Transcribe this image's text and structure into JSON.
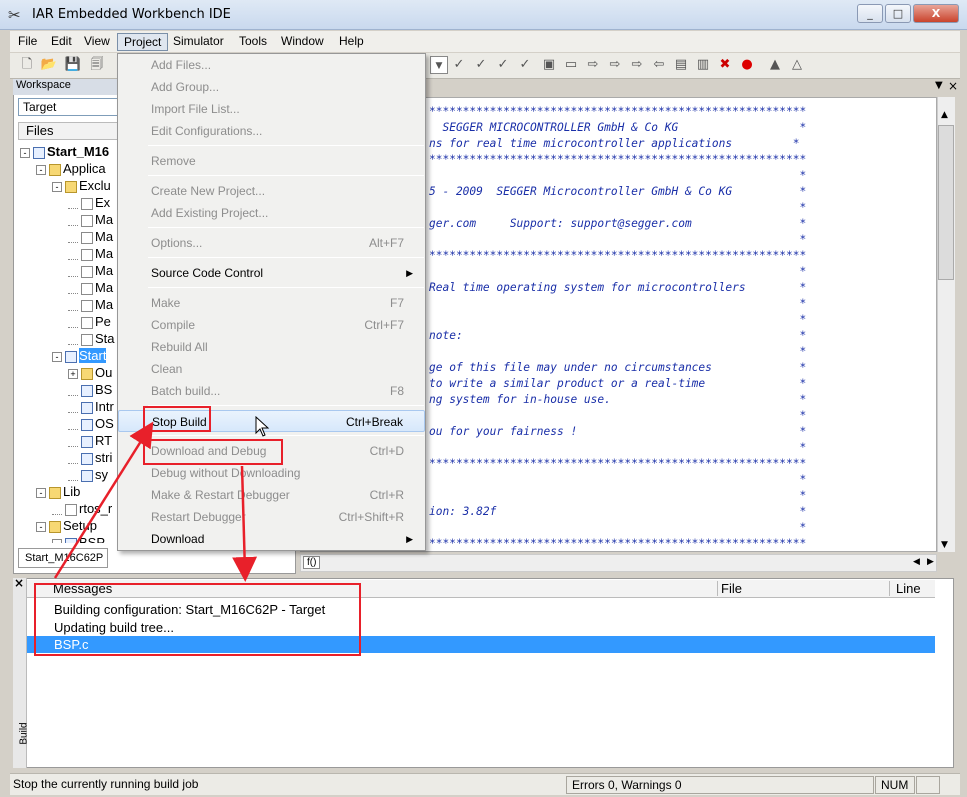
{
  "window": {
    "title": "IAR Embedded Workbench IDE",
    "icon": "iar-tool-icon"
  },
  "window_buttons": [
    "_",
    "□",
    "X"
  ],
  "menubar": [
    "File",
    "Edit",
    "View",
    "Project",
    "Simulator",
    "Tools",
    "Window",
    "Help"
  ],
  "workspace": {
    "header": "Workspace",
    "config": "Target",
    "files_header": "Files",
    "tab": "Start_M16C62P",
    "tree": [
      {
        "indent": 0,
        "text": "Start_M16",
        "icon": "project-icon",
        "exp": "-",
        "bold": true
      },
      {
        "indent": 1,
        "text": "Applica",
        "icon": "folder-icon",
        "exp": "-"
      },
      {
        "indent": 2,
        "text": "Exclu",
        "icon": "excluded-folder-icon",
        "exp": "-"
      },
      {
        "indent": 3,
        "text": "Ex",
        "icon": "excluded-file-icon",
        "exp": ""
      },
      {
        "indent": 3,
        "text": "Ma",
        "icon": "excluded-file-icon",
        "exp": ""
      },
      {
        "indent": 3,
        "text": "Ma",
        "icon": "excluded-file-icon",
        "exp": ""
      },
      {
        "indent": 3,
        "text": "Ma",
        "icon": "excluded-file-icon",
        "exp": ""
      },
      {
        "indent": 3,
        "text": "Ma",
        "icon": "excluded-file-icon",
        "exp": ""
      },
      {
        "indent": 3,
        "text": "Ma",
        "icon": "excluded-file-icon",
        "exp": ""
      },
      {
        "indent": 3,
        "text": "Ma",
        "icon": "excluded-file-icon",
        "exp": ""
      },
      {
        "indent": 3,
        "text": "Pe",
        "icon": "excluded-file-icon",
        "exp": ""
      },
      {
        "indent": 3,
        "text": "Sta",
        "icon": "excluded-file-icon",
        "exp": ""
      },
      {
        "indent": 2,
        "text": "Start",
        "icon": "c-file-icon",
        "exp": "-",
        "selected": true
      },
      {
        "indent": 3,
        "text": "Ou",
        "icon": "folder-icon",
        "exp": "+"
      },
      {
        "indent": 3,
        "text": "BS",
        "icon": "h-file-icon",
        "exp": ""
      },
      {
        "indent": 3,
        "text": "Intr",
        "icon": "h-file-icon",
        "exp": ""
      },
      {
        "indent": 3,
        "text": "OS",
        "icon": "h-file-icon",
        "exp": ""
      },
      {
        "indent": 3,
        "text": "RT",
        "icon": "h-file-icon",
        "exp": ""
      },
      {
        "indent": 3,
        "text": "stri",
        "icon": "h-file-icon",
        "exp": ""
      },
      {
        "indent": 3,
        "text": "sy",
        "icon": "h-file-icon",
        "exp": ""
      },
      {
        "indent": 1,
        "text": "Lib",
        "icon": "folder-icon",
        "exp": "-"
      },
      {
        "indent": 2,
        "text": "rtos_r",
        "icon": "lib-file-icon",
        "exp": ""
      },
      {
        "indent": 1,
        "text": "Setup",
        "icon": "folder-icon",
        "exp": "-"
      },
      {
        "indent": 2,
        "text": "BSP",
        "icon": "c-file-icon",
        "exp": "-"
      }
    ]
  },
  "editor": {
    "lines": [
      "********************************************************",
      "  SEGGER MICROCONTROLLER GmbH & Co KG                  *",
      "ns for real time microcontroller applications         *",
      "********************************************************",
      "                                                       *",
      "5 - 2009  SEGGER Microcontroller GmbH & Co KG          *",
      "                                                       *",
      "ger.com     Support: support@segger.com                *",
      "                                                       *",
      "********************************************************",
      "                                                       *",
      "Real time operating system for microcontrollers        *",
      "                                                       *",
      "                                                       *",
      "note:                                                  *",
      "                                                       *",
      "ge of this file may under no circumstances             *",
      "to write a similar product or a real-time              *",
      "ng system for in-house use.                            *",
      "                                                       *",
      "ou for your fairness !                                 *",
      "                                                       *",
      "********************************************************",
      "                                                       *",
      "                                                       *",
      "ion: 3.82f                                             *",
      "                                                       *",
      "********************************************************"
    ],
    "func_button": "f()"
  },
  "project_menu": {
    "items": [
      {
        "label": "Add Files...",
        "shortcut": "",
        "disabled": true
      },
      {
        "label": "Add Group...",
        "shortcut": "",
        "disabled": true
      },
      {
        "label": "Import File List...",
        "shortcut": "",
        "disabled": true
      },
      {
        "label": "Edit Configurations...",
        "shortcut": "",
        "disabled": true
      },
      {
        "sep": true
      },
      {
        "label": "Remove",
        "shortcut": "",
        "disabled": true
      },
      {
        "sep": true
      },
      {
        "label": "Create New Project...",
        "shortcut": "",
        "disabled": true
      },
      {
        "label": "Add Existing Project...",
        "shortcut": "",
        "disabled": true
      },
      {
        "sep": true
      },
      {
        "label": "Options...",
        "shortcut": "Alt+F7",
        "disabled": true
      },
      {
        "sep": true
      },
      {
        "label": "Source Code Control",
        "shortcut": "",
        "disabled": false,
        "submenu": true
      },
      {
        "sep": true
      },
      {
        "label": "Make",
        "shortcut": "F7",
        "disabled": true
      },
      {
        "label": "Compile",
        "shortcut": "Ctrl+F7",
        "disabled": true
      },
      {
        "label": "Rebuild All",
        "shortcut": "",
        "disabled": true
      },
      {
        "label": "Clean",
        "shortcut": "",
        "disabled": true
      },
      {
        "label": "Batch build...",
        "shortcut": "F8",
        "disabled": true
      },
      {
        "sep": true
      },
      {
        "label": "Stop Build",
        "shortcut": "Ctrl+Break",
        "disabled": false,
        "highlighted": true
      },
      {
        "sep": true
      },
      {
        "label": "Download and Debug",
        "shortcut": "Ctrl+D",
        "disabled": true
      },
      {
        "label": "Debug without Downloading",
        "shortcut": "",
        "disabled": true
      },
      {
        "label": "Make & Restart Debugger",
        "shortcut": "Ctrl+R",
        "disabled": true
      },
      {
        "label": "Restart Debugger",
        "shortcut": "Ctrl+Shift+R",
        "disabled": true
      },
      {
        "label": "Download",
        "shortcut": "",
        "disabled": false,
        "submenu": true
      }
    ]
  },
  "messages": {
    "columns": {
      "messages": "Messages",
      "file": "File",
      "line": "Line"
    },
    "side_label": "Build",
    "close": "×",
    "rows": [
      "Building configuration: Start_M16C62P - Target",
      "Updating build tree...",
      "BSP.c"
    ]
  },
  "statusbar": {
    "text": "Stop the currently running build job",
    "errors": "Errors 0, Warnings 0",
    "num": "NUM"
  },
  "colors": {
    "accent": "#3399ff",
    "annotation": "#e8202a",
    "code": "#1a2fa8"
  }
}
